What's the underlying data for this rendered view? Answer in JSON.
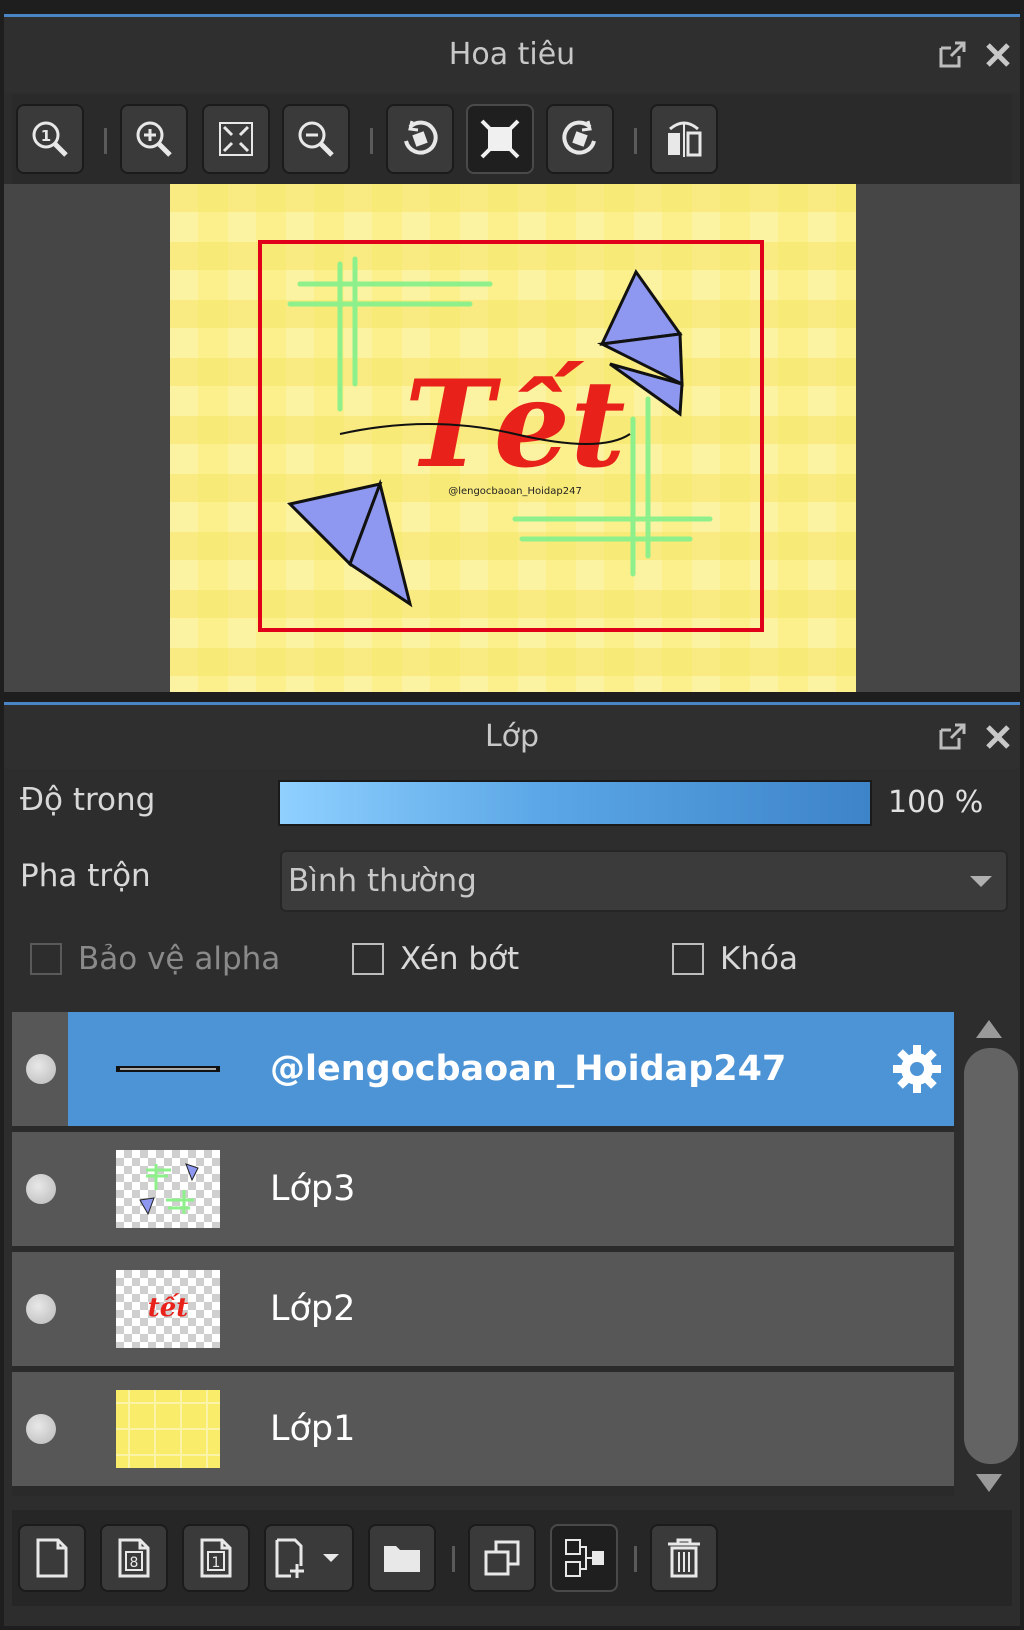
{
  "navigator": {
    "title": "Hoa tiêu",
    "toolbar_icons": [
      "zoom-actual-icon",
      "zoom-in-icon",
      "fit-screen-icon",
      "zoom-out-icon",
      "rotate-left-icon",
      "fit-width-icon",
      "rotate-right-icon",
      "flip-horizontal-icon"
    ],
    "preview": {
      "title_text": "Tết",
      "watermark": "@lengocbaoan_Hoidap247",
      "colors": {
        "background": "#fbf08b",
        "frame": "#e0001a",
        "kite": "#8e98f0",
        "lines": "#8ef08a",
        "title": "#e8221a"
      }
    }
  },
  "layers": {
    "title": "Lớp",
    "opacity": {
      "label": "Độ trong",
      "value": "100 %",
      "level_percent": 100
    },
    "blend": {
      "label": "Pha trộn",
      "value": "Bình thường"
    },
    "checkboxes": {
      "alpha": {
        "label": "Bảo vệ alpha",
        "checked": false,
        "disabled": true
      },
      "clip": {
        "label": "Xén bớt",
        "checked": false
      },
      "lock": {
        "label": "Khóa",
        "checked": false
      }
    },
    "items": [
      {
        "name": "@lengocbaoan_Hoidap247",
        "active": true,
        "visible": true
      },
      {
        "name": "Lớp3",
        "active": false,
        "visible": true
      },
      {
        "name": "Lớp2",
        "active": false,
        "visible": true
      },
      {
        "name": "Lớp1",
        "active": false,
        "visible": true
      }
    ],
    "bottom_icons": [
      "new-layer-icon",
      "new-8bit-layer-icon",
      "new-1bit-layer-icon",
      "add-layer-dropdown-icon",
      "new-folder-icon",
      "duplicate-layer-icon",
      "merge-down-icon",
      "delete-layer-icon"
    ]
  },
  "colors": {
    "accent": "#4c94d6",
    "panel": "#2d2d2d",
    "row": "#575757"
  }
}
